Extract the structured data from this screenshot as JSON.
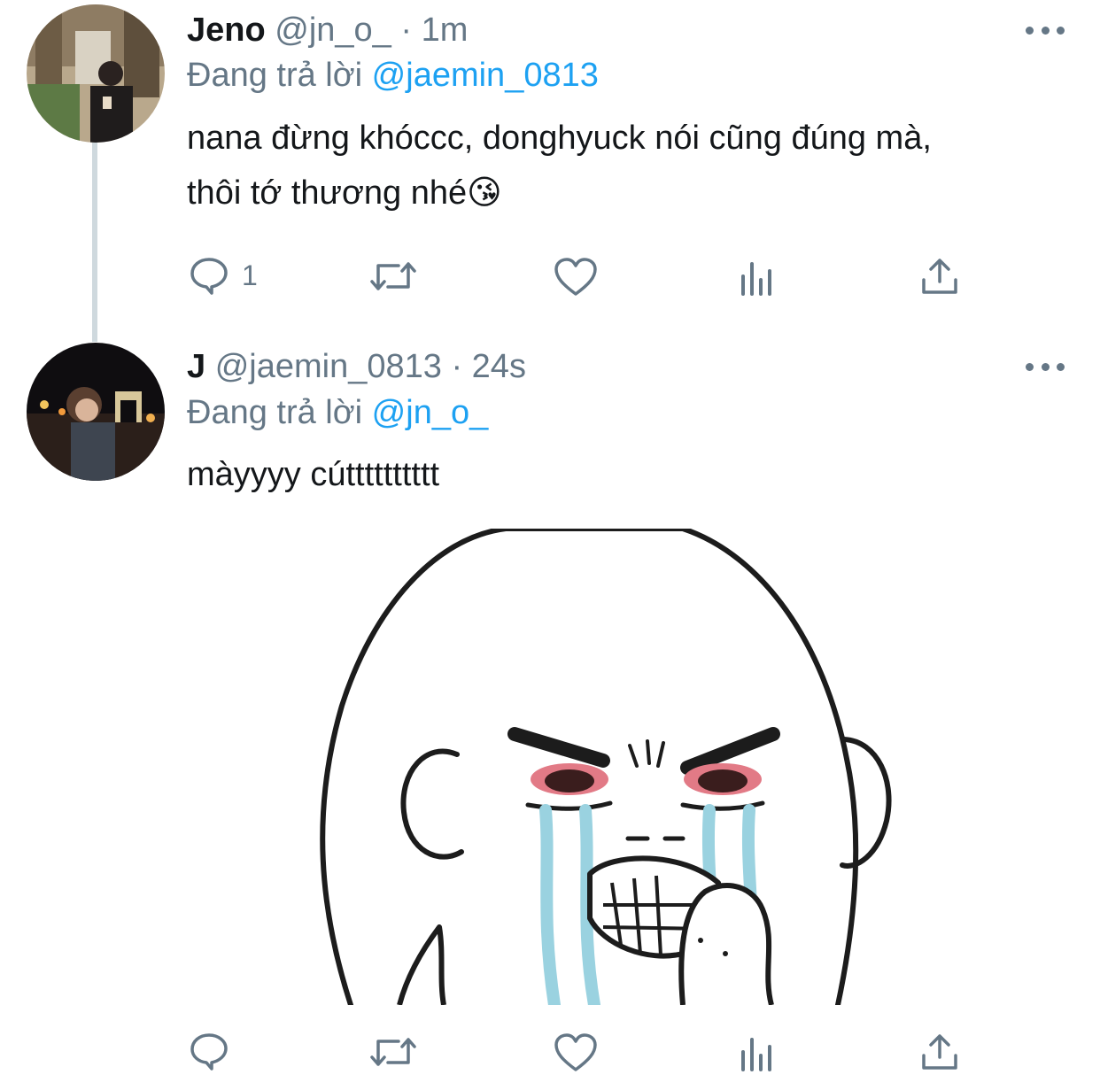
{
  "tweets": [
    {
      "name": "Jeno",
      "handle": "@jn_o_",
      "separator": "·",
      "time": "1m",
      "reply_prefix": "Đang trả lời",
      "reply_to": "@jaemin_0813",
      "text_line1": "nana đừng khóccc, donghyuck nói cũng đúng mà,",
      "text_line2": "thôi tớ thương nhé",
      "emoji": "😘",
      "reply_count": "1"
    },
    {
      "name": "J",
      "handle": "@jaemin_0813",
      "separator": "·",
      "time": "24s",
      "reply_prefix": "Đang trả lời",
      "reply_to": "@jn_o_",
      "text": "màyyyy cútttttttttt",
      "reply_count": ""
    }
  ],
  "icons": [
    "reply-icon",
    "retweet-icon",
    "like-icon",
    "analytics-icon",
    "share-icon",
    "more-icon"
  ],
  "colors": {
    "muted": "#657786",
    "link": "#1da1f2",
    "thread_line": "#cfd9de",
    "text": "#14171a"
  }
}
